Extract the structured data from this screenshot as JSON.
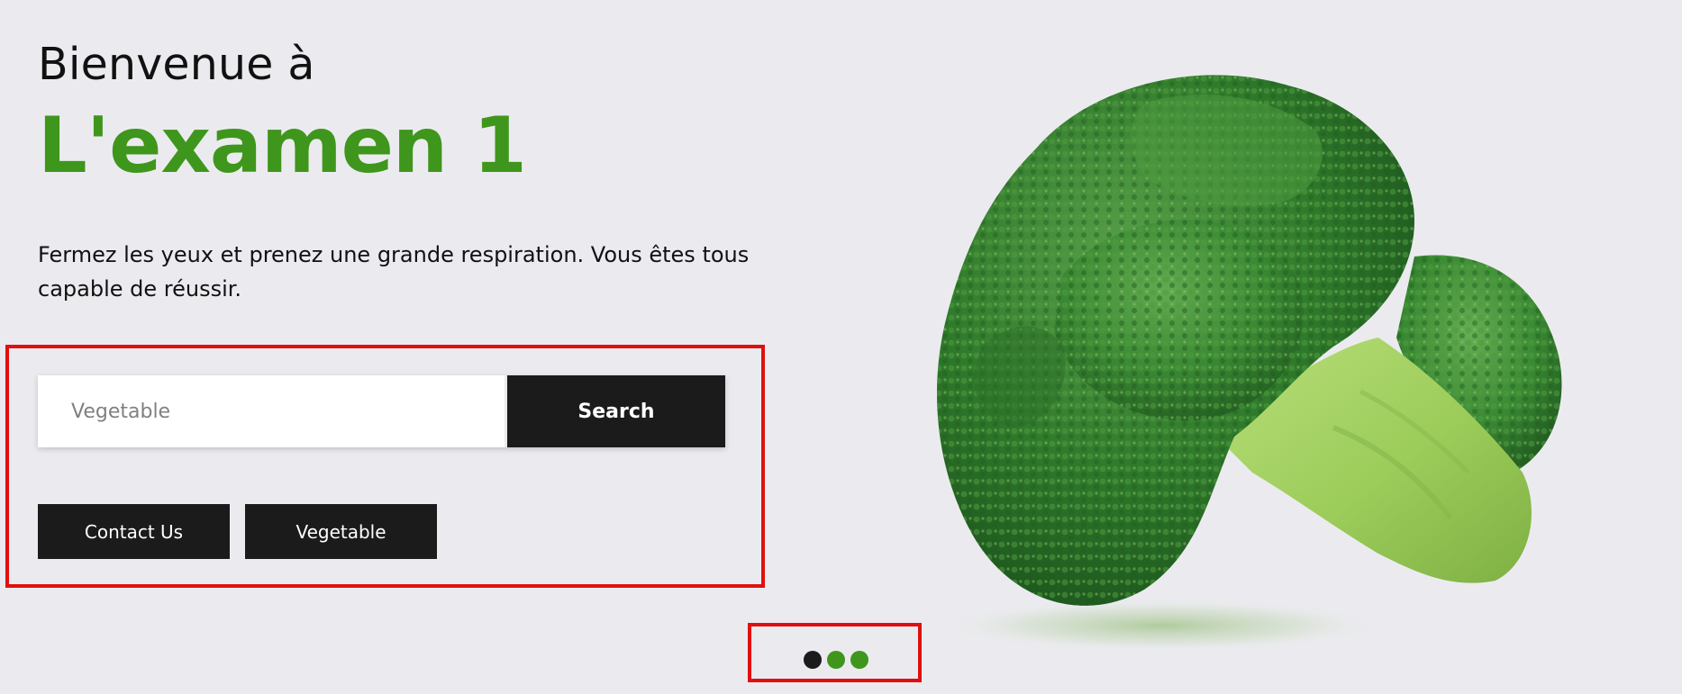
{
  "hero": {
    "greeting": "Bienvenue à",
    "title": "L'examen 1",
    "subtitle": "Fermez les yeux et prenez une grande respiration. Vous êtes tous capable de réussir."
  },
  "search": {
    "placeholder": "Vegetable",
    "button_label": "Search"
  },
  "buttons": {
    "contact_label": "Contact Us",
    "vegetable_label": "Vegetable"
  },
  "carousel": {
    "dots": [
      {
        "active": true,
        "color": "#1b1b1b"
      },
      {
        "active": false,
        "color": "#3f961c"
      },
      {
        "active": false,
        "color": "#3f961c"
      }
    ]
  },
  "image": {
    "icon": "broccoli-image"
  },
  "colors": {
    "accent": "#3f961c",
    "button_bg": "#1b1b1b",
    "page_bg": "#ebebef",
    "highlight": "#e01010"
  }
}
